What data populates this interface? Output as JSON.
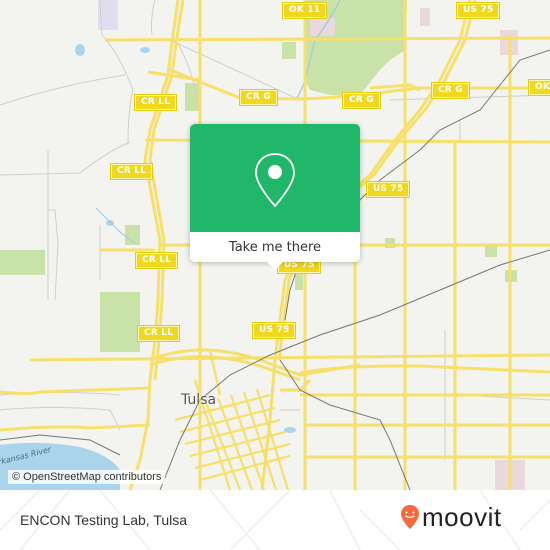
{
  "map": {
    "city_label": "Tulsa",
    "river_label": "Arkansas River",
    "attribution": "© OpenStreetMap contributors",
    "colors": {
      "background": "#f3f3ef",
      "road": "#f7e06a",
      "minor_road": "#cfcfcf",
      "park": "#c9e2a8",
      "water": "#a9d4ec",
      "railway": "#777777",
      "shield": "#f0d81e"
    },
    "road_shields": [
      {
        "id": "ok11-top",
        "label": "OK 11"
      },
      {
        "id": "us75-top",
        "label": "US 75"
      },
      {
        "id": "crll-1",
        "label": "CR LL"
      },
      {
        "id": "crg-1",
        "label": "CR G"
      },
      {
        "id": "crg-2",
        "label": "CR G"
      },
      {
        "id": "crg-3",
        "label": "CR G"
      },
      {
        "id": "ok-right",
        "label": "OK"
      },
      {
        "id": "crll-2",
        "label": "CR LL"
      },
      {
        "id": "us75-mid",
        "label": "US 75"
      },
      {
        "id": "crll-3",
        "label": "CR LL"
      },
      {
        "id": "us75-popup",
        "label": "US 75"
      },
      {
        "id": "crll-4",
        "label": "CR LL"
      },
      {
        "id": "us75-low",
        "label": "US 75"
      }
    ]
  },
  "popup": {
    "icon": "location-pin-icon",
    "button_label": "Take me there",
    "color": "#21b76b"
  },
  "footer": {
    "place_name": "ENCON Testing Lab, Tulsa",
    "brand": "moovit",
    "brand_color": "#f26a3d"
  }
}
